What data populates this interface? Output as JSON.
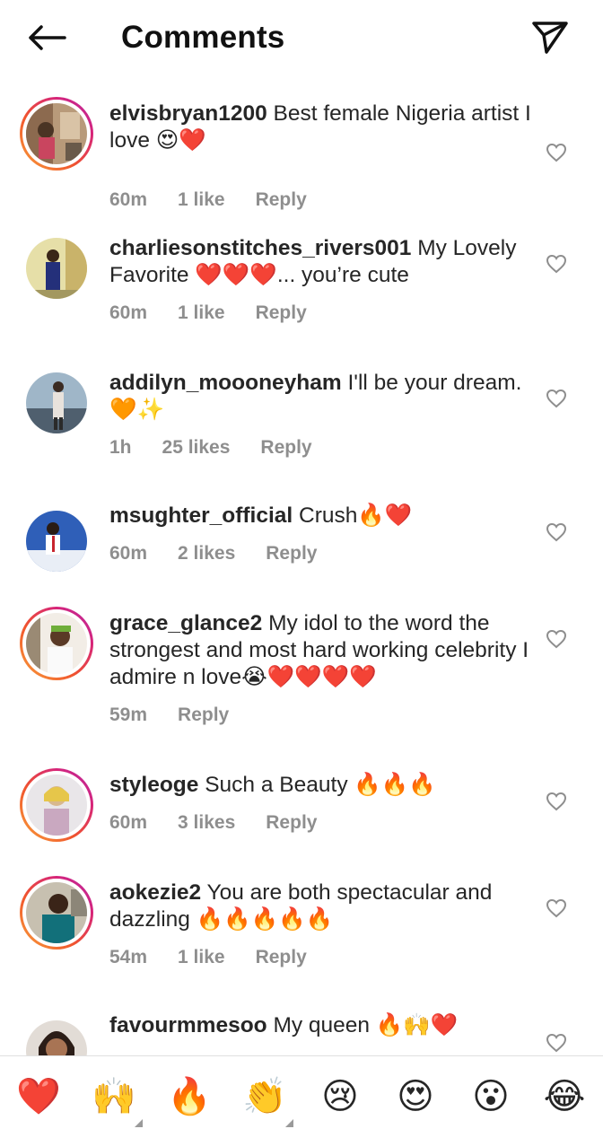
{
  "header": {
    "title": "Comments",
    "back_icon": "arrow-left-icon",
    "send_icon": "paper-plane-icon"
  },
  "comments": [
    {
      "username": "elvisbryan1200",
      "text": "Best female Nigeria artist I love 😍❤️",
      "time": "60m",
      "likes": "1 like",
      "reply": "Reply",
      "story_ring": true
    },
    {
      "username": "charliesonstitches_rivers001",
      "text": "My Lovely Favorite ❤️❤️❤️... you’re cute",
      "time": "60m",
      "likes": "1 like",
      "reply": "Reply",
      "story_ring": false
    },
    {
      "username": "addilyn_moooneyham",
      "text": "I'll be your dream.🧡✨",
      "time": "1h",
      "likes": "25 likes",
      "reply": "Reply",
      "story_ring": false
    },
    {
      "username": "msughter_official",
      "text": "Crush🔥❤️",
      "time": "60m",
      "likes": "2 likes",
      "reply": "Reply",
      "story_ring": false
    },
    {
      "username": "grace_glance2",
      "text": "My idol to the word the strongest and most hard working celebrity I admire n love😭❤️❤️❤️❤️",
      "time": "59m",
      "likes": "",
      "reply": "Reply",
      "story_ring": true
    },
    {
      "username": "styleoge",
      "text": "Such a Beauty 🔥🔥🔥",
      "time": "60m",
      "likes": "3 likes",
      "reply": "Reply",
      "story_ring": true
    },
    {
      "username": "aokezie2",
      "text": "You are both spectacular and dazzling 🔥🔥🔥🔥🔥",
      "time": "54m",
      "likes": "1 like",
      "reply": "Reply",
      "story_ring": true
    },
    {
      "username": "favourmmesoo",
      "text": "My queen 🔥🙌❤️",
      "time": "",
      "likes": "",
      "reply": "",
      "story_ring": false
    }
  ],
  "emoji_bar": [
    {
      "emoji": "❤️",
      "name": "red-heart"
    },
    {
      "emoji": "🙌",
      "name": "raising-hands"
    },
    {
      "emoji": "🔥",
      "name": "fire"
    },
    {
      "emoji": "👏",
      "name": "clapping-hands"
    },
    {
      "emoji": "😢",
      "name": "crying-face"
    },
    {
      "emoji": "😍",
      "name": "heart-eyes"
    },
    {
      "emoji": "😮",
      "name": "surprised-face"
    },
    {
      "emoji": "😂",
      "name": "tears-of-joy"
    }
  ],
  "colors": {
    "text": "#262626",
    "meta": "#8e8e8e",
    "ring_start": "#f9a23a",
    "ring_end": "#b42ca8"
  }
}
